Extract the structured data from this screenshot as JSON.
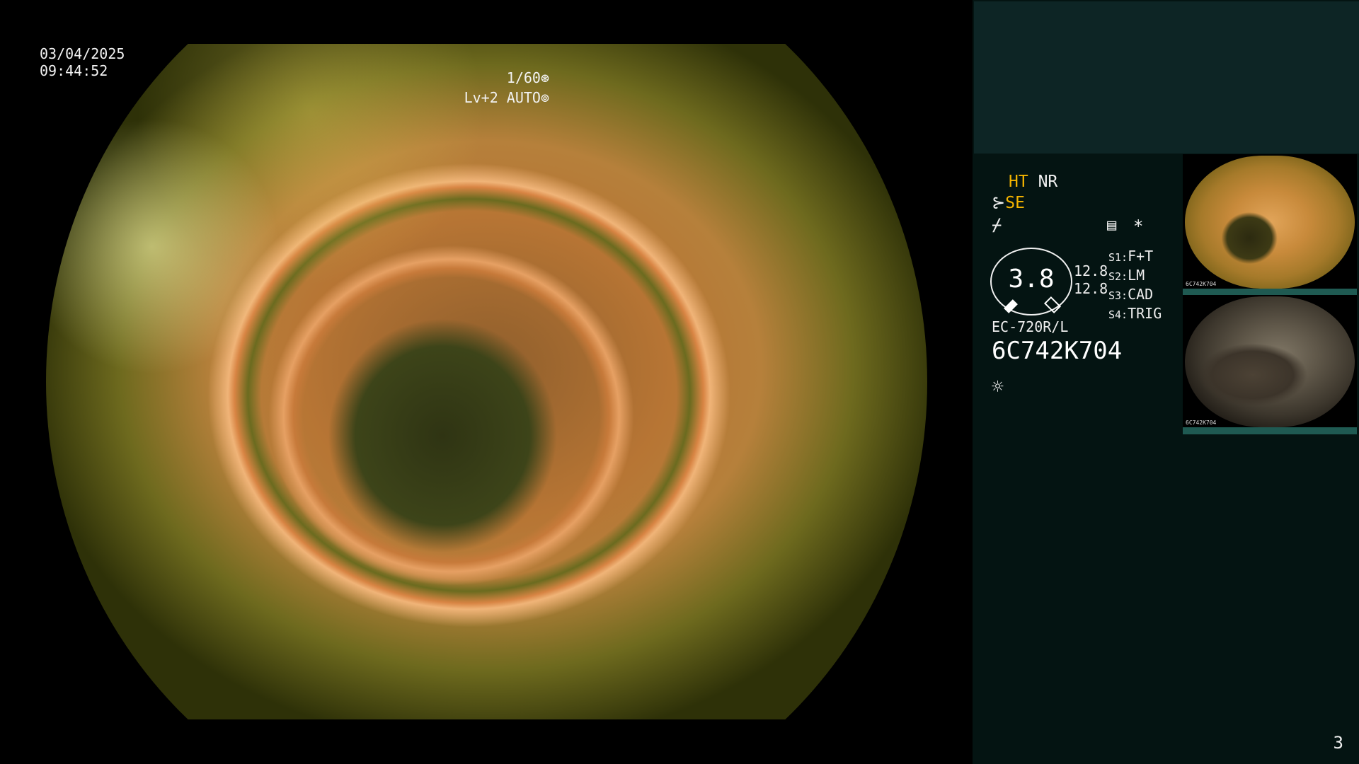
{
  "overlay": {
    "date": "03/04/2025",
    "time": "09:44:52",
    "shutter": "1/60",
    "shutter_icon": "aperture-icon",
    "level": "Lv+2 AUTO",
    "level_icon": "iris-icon"
  },
  "side_panel": {
    "mode1": "HT",
    "mode2": "NR",
    "se_label": "SE",
    "gauge_value": "3.8",
    "left_values": [
      "12.8",
      "12.8"
    ],
    "switches": [
      {
        "key": "S1:",
        "value": "F+T"
      },
      {
        "key": "S2:",
        "value": "LM"
      },
      {
        "key": "S3:",
        "value": "CAD"
      },
      {
        "key": "S4:",
        "value": "TRIG"
      }
    ],
    "scope_model": "EC-720R/L",
    "scope_serial": "6C742K704",
    "asterisk": "*"
  },
  "thumbnails": [
    {
      "tag": "6C742K704"
    },
    {
      "tag": "6C742K704"
    }
  ],
  "page_number": "3",
  "colors": {
    "accent_orange": "#f5b400",
    "panel_bg": "#041412",
    "panel_top": "#0d2525",
    "thumb_bar": "#1f5a52"
  }
}
